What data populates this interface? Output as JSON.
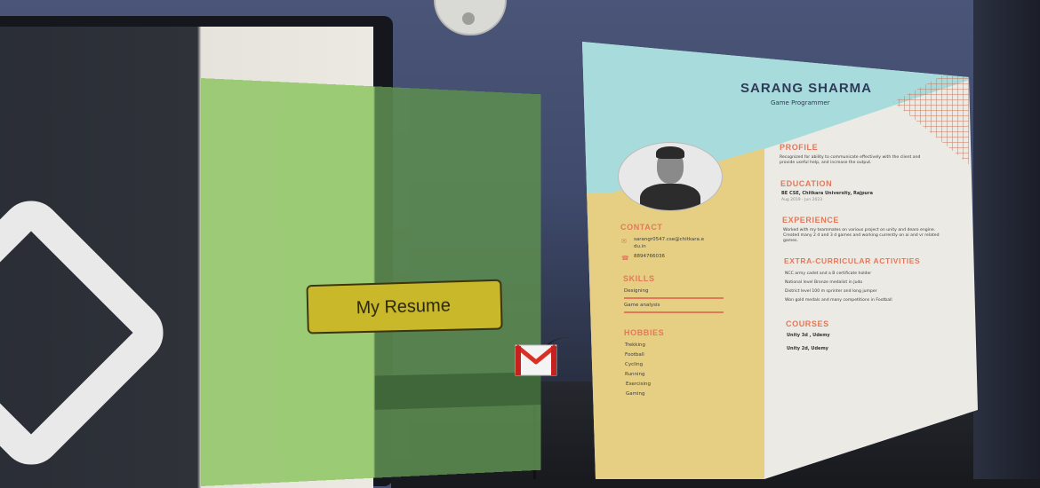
{
  "ar_button": {
    "label": "My Resume"
  },
  "email_icon": {
    "icon": "gmail-icon"
  },
  "resume": {
    "name": "SARANG SHARMA",
    "role": "Game Programmer",
    "sidebar": {
      "contact": {
        "title": "CONTACT",
        "email_line1": "sarangr0547.cse@chitkara.e",
        "email_line2": "du.in",
        "phone": "8894766036"
      },
      "skills": {
        "title": "SKILLS",
        "items": [
          "Designing",
          "Game analysis"
        ]
      },
      "hobbies": {
        "title": "HOBBIES",
        "items": [
          "Trekking",
          "Football",
          "Cycling",
          "Running",
          "Exercising",
          "Gaming"
        ]
      }
    },
    "main": {
      "profile": {
        "title": "PROFILE",
        "line1": "Recognized for ability to communicate effectively with the client and",
        "line2": "provide useful help, and increase the output."
      },
      "education": {
        "title": "EDUCATION",
        "degree": "BE CSE, Chitkara University, Rajpura",
        "dates": "Aug 2019 - Jun 2023"
      },
      "experience": {
        "title": "EXPERIENCE",
        "line1": "Worked with my teammates on various project on unity and dearo engine.",
        "line2": "Created many 2 d and 3 d games and working currently on ai and vr related",
        "line3": "games."
      },
      "extracurricular": {
        "title": "EXTRA-CURRICULAR ACTIVITIES",
        "items": [
          "NCC army cadet and a B certificate holder",
          "National level Bronze medalist in Judo",
          "District level 100 m sprinter and long jumper",
          "Won gold medals and many competitions in Football"
        ]
      },
      "courses": {
        "title": "COURSES",
        "items": [
          "Unity 3d , Udemy",
          "Unity 2d, Udemy"
        ]
      }
    },
    "colors": {
      "accent": "#e2785a",
      "header_bg": "#a8dcdc",
      "sidebar_bg": "#e6cf82",
      "name": "#2f3a5a"
    }
  }
}
